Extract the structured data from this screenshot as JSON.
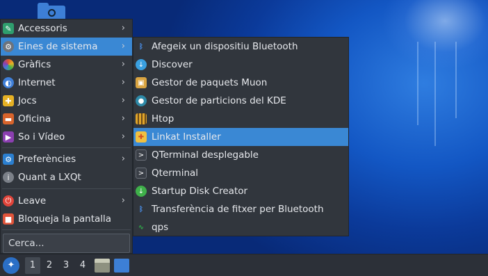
{
  "main_menu": {
    "items": [
      {
        "label": "Accessoris",
        "icon": "accessories-icon",
        "color": "#2f9e6e",
        "submenu": true
      },
      {
        "label": "Eines de sistema",
        "icon": "gear-icon",
        "color": "#6d737c",
        "submenu": true,
        "active": true
      },
      {
        "label": "Gràfics",
        "icon": "graphics-icon",
        "color": "#e0582f",
        "submenu": true
      },
      {
        "label": "Internet",
        "icon": "globe-icon",
        "color": "#3f7fd8",
        "submenu": true
      },
      {
        "label": "Jocs",
        "icon": "gamepad-icon",
        "color": "#e6b124",
        "submenu": true
      },
      {
        "label": "Oficina",
        "icon": "briefcase-icon",
        "color": "#d8642c",
        "submenu": true
      },
      {
        "label": "So i Vídeo",
        "icon": "multimedia-icon",
        "color": "#8b3fb0",
        "submenu": true
      },
      {
        "label": "Preferències",
        "icon": "preferences-icon",
        "color": "#2b7fd0",
        "submenu": true
      },
      {
        "label": "Quant a LXQt",
        "icon": "info-icon",
        "color": "#7b8088",
        "submenu": false
      },
      {
        "label": "Leave",
        "icon": "power-icon",
        "color": "#e0443a",
        "submenu": true
      },
      {
        "label": "Bloqueja la pantalla",
        "icon": "lock-icon",
        "color": "#e0543a",
        "submenu": false
      }
    ]
  },
  "search": {
    "placeholder": "Cerca..."
  },
  "submenu": {
    "items": [
      {
        "label": "Afegeix un dispositiu Bluetooth",
        "icon": "bluetooth-icon",
        "color": "#2b5fb0"
      },
      {
        "label": "Discover",
        "icon": "discover-icon",
        "color": "#3aa0e0"
      },
      {
        "label": "Gestor de paquets Muon",
        "icon": "package-icon",
        "color": "#d9a441"
      },
      {
        "label": "Gestor de particions del KDE",
        "icon": "partition-icon",
        "color": "#2e8aa8"
      },
      {
        "label": "Htop",
        "icon": "htop-icon",
        "color": "#b07a2a"
      },
      {
        "label": "Linkat Installer",
        "icon": "installer-icon",
        "color": "#d86a2a",
        "active": true
      },
      {
        "label": "QTerminal desplegable",
        "icon": "terminal-icon",
        "color": "#3a3f47"
      },
      {
        "label": "Qterminal",
        "icon": "terminal-icon",
        "color": "#3a3f47"
      },
      {
        "label": "Startup Disk Creator",
        "icon": "download-icon",
        "color": "#3fb04a"
      },
      {
        "label": "Transferència de fitxer per Bluetooth",
        "icon": "bluetooth-icon",
        "color": "#2b5fb0"
      },
      {
        "label": "qps",
        "icon": "activity-icon",
        "color": "#2fae4a"
      }
    ]
  },
  "taskbar": {
    "workspaces": [
      "1",
      "2",
      "3",
      "4"
    ],
    "active_workspace": "1"
  }
}
